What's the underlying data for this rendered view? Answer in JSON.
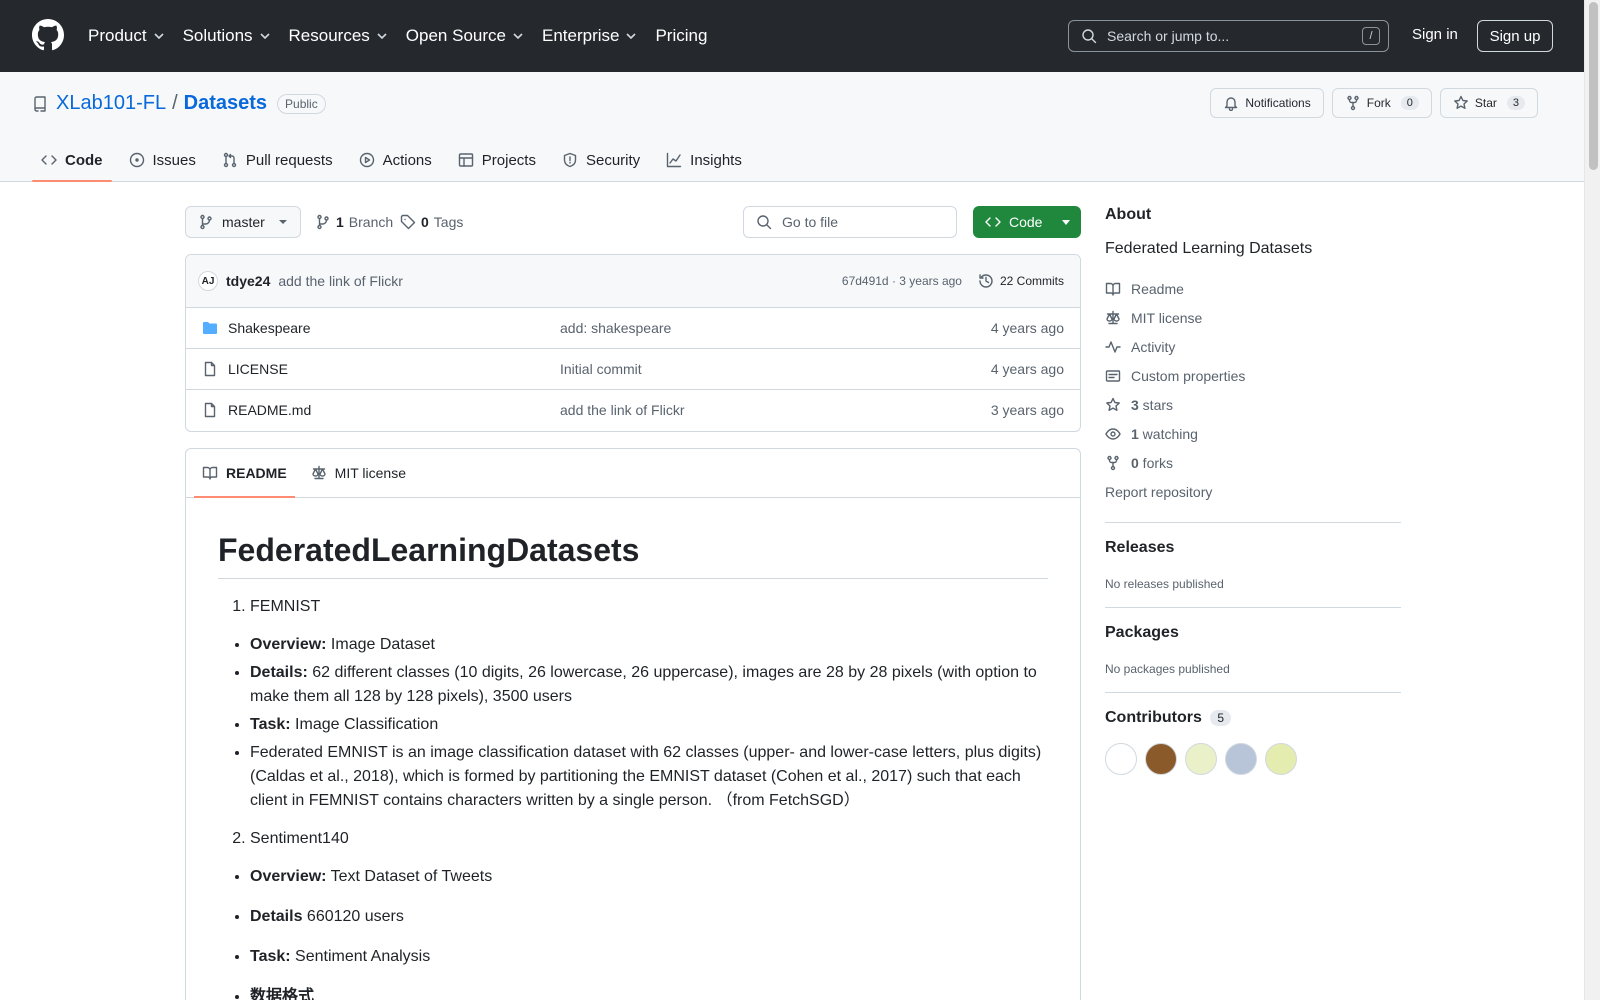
{
  "header": {
    "nav": [
      {
        "label": "Product",
        "dropdown": true
      },
      {
        "label": "Solutions",
        "dropdown": true
      },
      {
        "label": "Resources",
        "dropdown": true
      },
      {
        "label": "Open Source",
        "dropdown": true
      },
      {
        "label": "Enterprise",
        "dropdown": true
      },
      {
        "label": "Pricing",
        "dropdown": false
      }
    ],
    "search_placeholder": "Search or jump to...",
    "search_shortcut": "/",
    "sign_in": "Sign in",
    "sign_up": "Sign up"
  },
  "repo": {
    "owner": "XLab101-FL",
    "separator": "/",
    "name": "Datasets",
    "visibility": "Public",
    "notifications_label": "Notifications",
    "fork_label": "Fork",
    "fork_count": "0",
    "star_label": "Star",
    "star_count": "3",
    "tabs": [
      {
        "label": "Code",
        "icon": "code-icon",
        "active": true
      },
      {
        "label": "Issues",
        "icon": "issue-icon",
        "active": false
      },
      {
        "label": "Pull requests",
        "icon": "pull-request-icon",
        "active": false
      },
      {
        "label": "Actions",
        "icon": "play-icon",
        "active": false
      },
      {
        "label": "Projects",
        "icon": "table-icon",
        "active": false
      },
      {
        "label": "Security",
        "icon": "shield-icon",
        "active": false
      },
      {
        "label": "Insights",
        "icon": "graph-icon",
        "active": false
      }
    ]
  },
  "toolbar": {
    "branch": "master",
    "branch_count": "1",
    "branch_label": "Branch",
    "tag_count": "0",
    "tag_label": "Tags",
    "goto_placeholder": "Go to file",
    "code_button": "Code"
  },
  "commit": {
    "author": "tdye24",
    "avatar_text": "AJ",
    "message": "add the link of Flickr",
    "sha_time": "67d491d · 3 years ago",
    "commits": "22 Commits"
  },
  "files": [
    {
      "name": "Shakespeare",
      "type": "folder",
      "message": "add: shakespeare",
      "age": "4 years ago"
    },
    {
      "name": "LICENSE",
      "type": "file",
      "message": "Initial commit",
      "age": "4 years ago"
    },
    {
      "name": "README.md",
      "type": "file",
      "message": "add the link of Flickr",
      "age": "3 years ago"
    }
  ],
  "readme": {
    "tab_readme": "README",
    "tab_license": "MIT license",
    "title": "FederatedLearningDatasets",
    "section1": {
      "heading": "FEMNIST",
      "items": [
        {
          "label": "Overview:",
          "text": " Image Dataset"
        },
        {
          "label": "Details:",
          "text": " 62 different classes (10 digits, 26 lowercase, 26 uppercase), images are 28 by 28 pixels (with option to make them all 128 by 128 pixels), 3500 users"
        },
        {
          "label": "Task:",
          "text": " Image Classification"
        },
        {
          "label": "",
          "text": "Federated EMNIST is an image classification dataset with 62 classes (upper- and lower-case letters, plus digits) (Caldas et al., 2018), which is formed by partitioning the EMNIST dataset (Cohen et al., 2017) such that each client in FEMNIST contains characters written by a single person. （from FetchSGD）"
        }
      ]
    },
    "section2": {
      "heading": "Sentiment140",
      "items": [
        {
          "label": "Overview:",
          "text": " Text Dataset of Tweets"
        },
        {
          "label": "Details",
          "text": " 660120 users"
        },
        {
          "label": "Task:",
          "text": " Sentiment Analysis"
        },
        {
          "label": "数据格式",
          "text": ""
        }
      ]
    }
  },
  "sidebar": {
    "about_title": "About",
    "description": "Federated Learning Datasets",
    "links": [
      {
        "icon": "book-icon",
        "count": "",
        "label": "Readme"
      },
      {
        "icon": "law-icon",
        "count": "",
        "label": "MIT license"
      },
      {
        "icon": "pulse-icon",
        "count": "",
        "label": "Activity"
      },
      {
        "icon": "note-icon",
        "count": "",
        "label": "Custom properties"
      },
      {
        "icon": "star-icon",
        "count": "3",
        "label": " stars"
      },
      {
        "icon": "eye-icon",
        "count": "1",
        "label": " watching"
      },
      {
        "icon": "fork-icon",
        "count": "0",
        "label": " forks"
      }
    ],
    "report": "Report repository",
    "releases_title": "Releases",
    "releases_text": "No releases published",
    "packages_title": "Packages",
    "packages_text": "No packages published",
    "contributors_title": "Contributors",
    "contributors_count": "5",
    "contributor_colors": [
      "#ffffff",
      "#8a5a2b",
      "#eaf0c8",
      "#b8c4d8",
      "#e4ecb0"
    ]
  }
}
